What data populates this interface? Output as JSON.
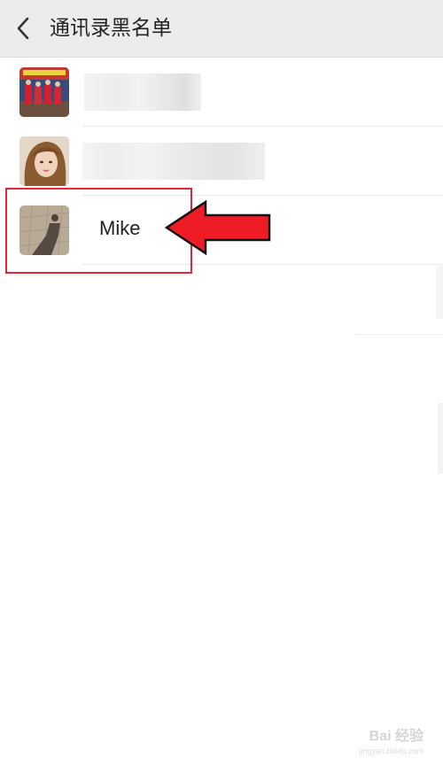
{
  "header": {
    "title": "通讯录黑名单"
  },
  "contacts": [
    {
      "name": "",
      "avatar": "group-photo"
    },
    {
      "name": "",
      "avatar": "woman-portrait"
    },
    {
      "name": "Mike",
      "avatar": "shadow-photo"
    }
  ],
  "watermark": {
    "brand": "Bai 经验",
    "url": "jingyan.baidu.com"
  },
  "colors": {
    "header_bg": "#ececec",
    "highlight": "#e5253a",
    "arrow": "#ee1c25"
  }
}
